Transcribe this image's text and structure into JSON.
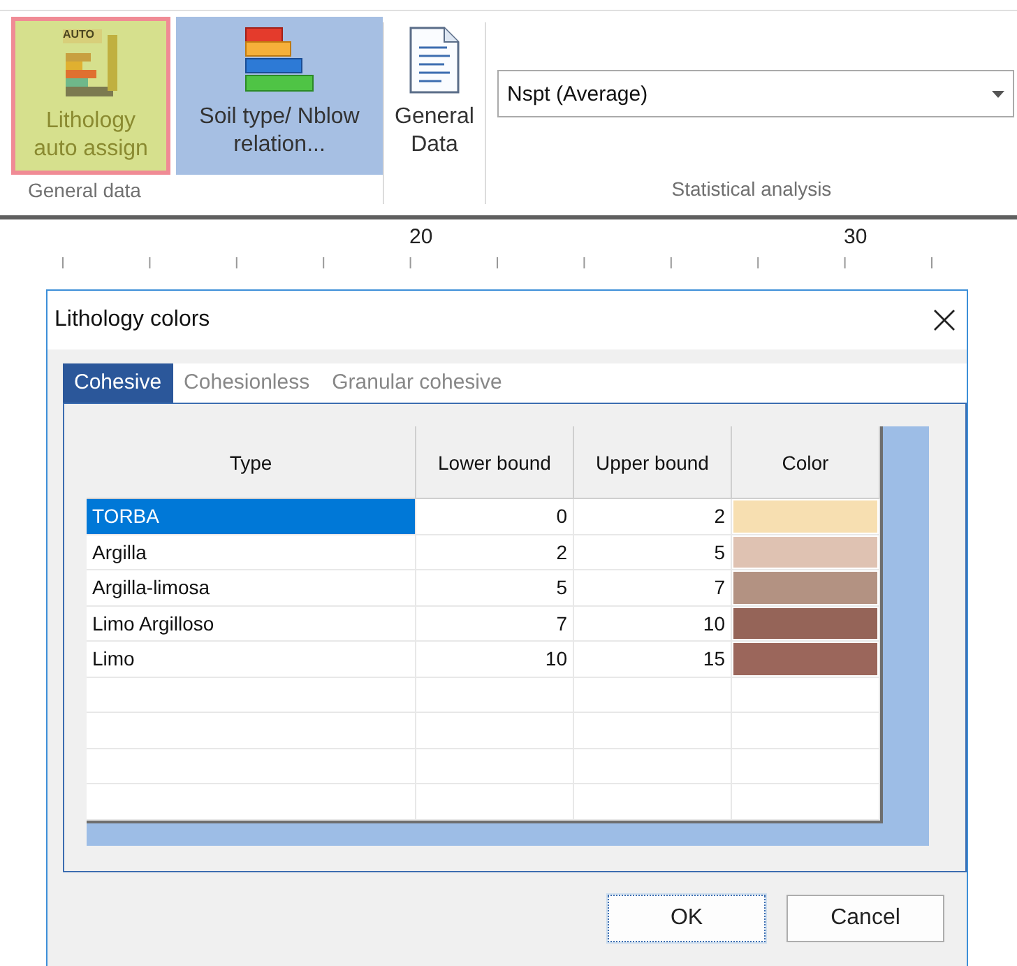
{
  "ribbon": {
    "groups": [
      {
        "label": "General data",
        "buttons": [
          {
            "kind": "lithology",
            "label": "Lithology auto assign",
            "icon_badge": "AUTO",
            "hovered": true,
            "selected": false
          },
          {
            "kind": "soil",
            "label": "Soil type/ Nblow relation...",
            "hovered": false,
            "selected": true
          }
        ]
      },
      {
        "buttons": [
          {
            "kind": "document",
            "label": "General Data",
            "hovered": false,
            "selected": false
          }
        ]
      },
      {
        "label": "Statistical analysis",
        "dropdown": {
          "value": "Nspt (Average)"
        }
      }
    ]
  },
  "ruler": {
    "labels": [
      "20",
      "30"
    ]
  },
  "dialog": {
    "title": "Lithology colors",
    "tabs": [
      {
        "label": "Cohesive",
        "selected": true
      },
      {
        "label": "Cohesionless",
        "selected": false
      },
      {
        "label": "Granular cohesive",
        "selected": false
      }
    ],
    "table": {
      "columns": [
        "Type",
        "Lower bound",
        "Upper bound",
        "Color"
      ],
      "rows": [
        {
          "type": "TORBA",
          "lower": "0",
          "upper": "2",
          "color": "#f7dfb1",
          "selected": true
        },
        {
          "type": "Argilla",
          "lower": "2",
          "upper": "5",
          "color": "#dfc2b2",
          "selected": false
        },
        {
          "type": "Argilla-limosa",
          "lower": "5",
          "upper": "7",
          "color": "#b39282",
          "selected": false
        },
        {
          "type": "Limo Argilloso",
          "lower": "7",
          "upper": "10",
          "color": "#956458",
          "selected": false
        },
        {
          "type": "Limo",
          "lower": "10",
          "upper": "15",
          "color": "#9b665b",
          "selected": false
        }
      ]
    },
    "buttons": [
      {
        "label": "OK",
        "default": true
      },
      {
        "label": "Cancel",
        "default": false
      }
    ]
  }
}
